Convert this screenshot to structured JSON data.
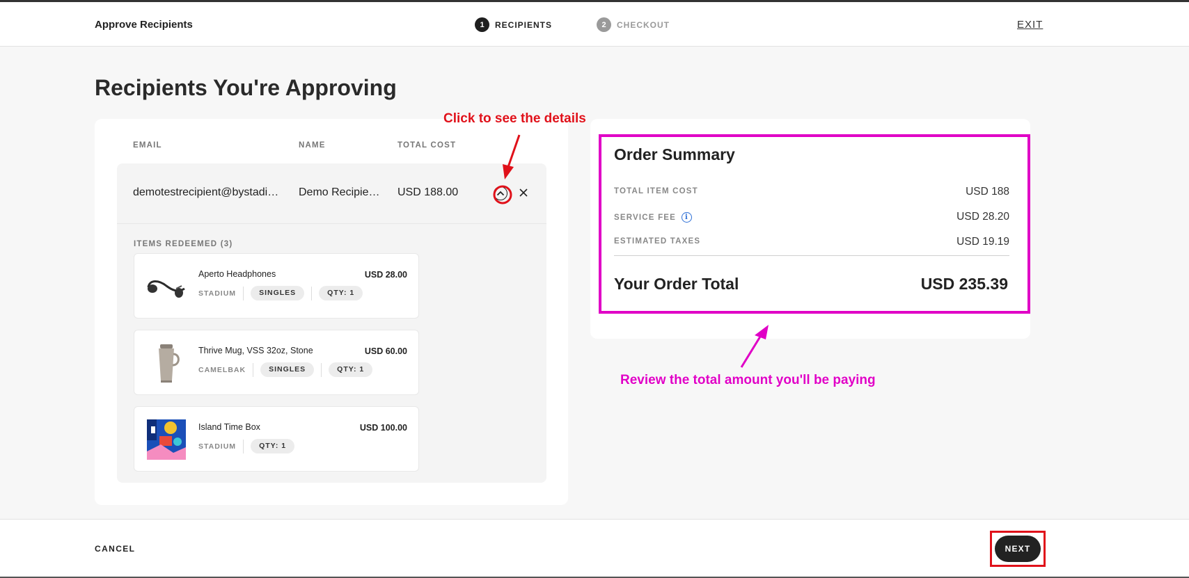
{
  "header": {
    "title": "Approve Recipients",
    "steps": [
      {
        "num": "1",
        "label": "RECIPIENTS"
      },
      {
        "num": "2",
        "label": "CHECKOUT"
      }
    ],
    "exit_label": "EXIT"
  },
  "main": {
    "page_title": "Recipients You're Approving",
    "columns": {
      "email": "EMAIL",
      "name": "NAME",
      "total_cost": "TOTAL COST"
    },
    "recipient": {
      "email": "demotestrecipient@bystadi…",
      "name": "Demo Recipie…",
      "total_cost": "USD 188.00"
    },
    "items_label": "ITEMS REDEEMED (3)",
    "items": [
      {
        "name": "Aperto Headphones",
        "price": "USD 28.00",
        "brand": "STADIUM",
        "tag": "SINGLES",
        "qty": "QTY: 1",
        "icon": "headphones-icon"
      },
      {
        "name": "Thrive Mug, VSS 32oz, Stone",
        "price": "USD 60.00",
        "brand": "CAMELBAK",
        "tag": "SINGLES",
        "qty": "QTY: 1",
        "icon": "mug-icon"
      },
      {
        "name": "Island Time Box",
        "price": "USD 100.00",
        "brand": "STADIUM",
        "qty": "QTY: 1",
        "icon": "gift-box-icon"
      }
    ]
  },
  "summary": {
    "title": "Order Summary",
    "rows": [
      {
        "label": "TOTAL ITEM COST",
        "value": "USD 188"
      },
      {
        "label": "SERVICE FEE",
        "value": "USD 28.20"
      },
      {
        "label": "ESTIMATED TAXES",
        "value": "USD 19.19"
      }
    ],
    "info_icon": "i",
    "total_label": "Your Order Total",
    "total_value": "USD 235.39"
  },
  "annotations": {
    "details_hint": "Click to see the details",
    "total_hint": "Review the total amount you'll be paying",
    "red": "#e0111a",
    "pink": "#e000c6"
  },
  "footer": {
    "cancel_label": "CANCEL",
    "next_label": "NEXT"
  }
}
